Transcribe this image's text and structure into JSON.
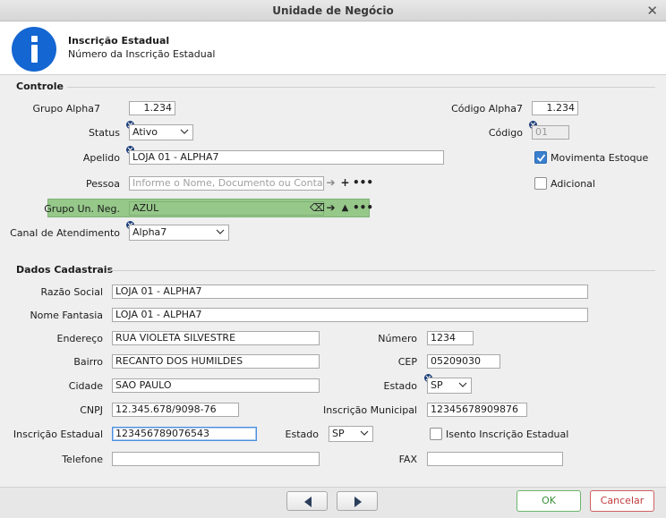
{
  "window": {
    "title": "Unidade de Negócio"
  },
  "header": {
    "title": "Inscrição Estadual",
    "subtitle": "Número da Inscrição Estadual"
  },
  "controle": {
    "section_title": "Controle",
    "grupo_alpha7_label": "Grupo Alpha7",
    "grupo_alpha7_value": "1.234",
    "codigo_alpha7_label": "Código Alpha7",
    "codigo_alpha7_value": "1.234",
    "status_label": "Status",
    "status_value": "Ativo",
    "codigo_label": "Código",
    "codigo_value": "01",
    "apelido_label": "Apelido",
    "apelido_value": "LOJA 01 - ALPHA7",
    "movimenta_estoque_label": "Movimenta Estoque",
    "movimenta_estoque_checked": true,
    "pessoa_label": "Pessoa",
    "pessoa_placeholder": "Informe o Nome, Documento ou Contato",
    "adicional_label": "Adicional",
    "adicional_checked": false,
    "grupo_un_neg_label": "Grupo Un. Neg.",
    "grupo_un_neg_value": "AZUL",
    "canal_label": "Canal de Atendimento",
    "canal_value": "Alpha7"
  },
  "cadastrais": {
    "section_title": "Dados Cadastrais",
    "razao_social_label": "Razão Social",
    "razao_social_value": "LOJA 01 - ALPHA7",
    "nome_fantasia_label": "Nome Fantasia",
    "nome_fantasia_value": "LOJA 01 - ALPHA7",
    "endereco_label": "Endereço",
    "endereco_value": "RUA VIOLETA SILVESTRE",
    "numero_label": "Número",
    "numero_value": "1234",
    "bairro_label": "Bairro",
    "bairro_value": "RECANTO DOS HUMILDES",
    "cep_label": "CEP",
    "cep_value": "05209030",
    "cidade_label": "Cidade",
    "cidade_value": "SAO PAULO",
    "estado_label": "Estado",
    "estado_value": "SP",
    "cnpj_label": "CNPJ",
    "cnpj_value": "12.345.678/9098-76",
    "insc_municipal_label": "Inscrição Municipal",
    "insc_municipal_value": "12345678909876",
    "insc_estadual_label": "Inscrição Estadual",
    "insc_estadual_value": "123456789076543",
    "estado2_label": "Estado",
    "estado2_value": "SP",
    "isento_label": "Isento Inscrição Estadual",
    "isento_checked": false,
    "telefone_label": "Telefone",
    "telefone_value": "",
    "fax_label": "FAX",
    "fax_value": ""
  },
  "footer": {
    "ok_label": "OK",
    "cancel_label": "Cancelar"
  },
  "colors": {
    "accent": "#1466d2",
    "group_highlight": "#96c88a",
    "ok": "#3c8f3c",
    "cancel": "#c03b3b"
  }
}
